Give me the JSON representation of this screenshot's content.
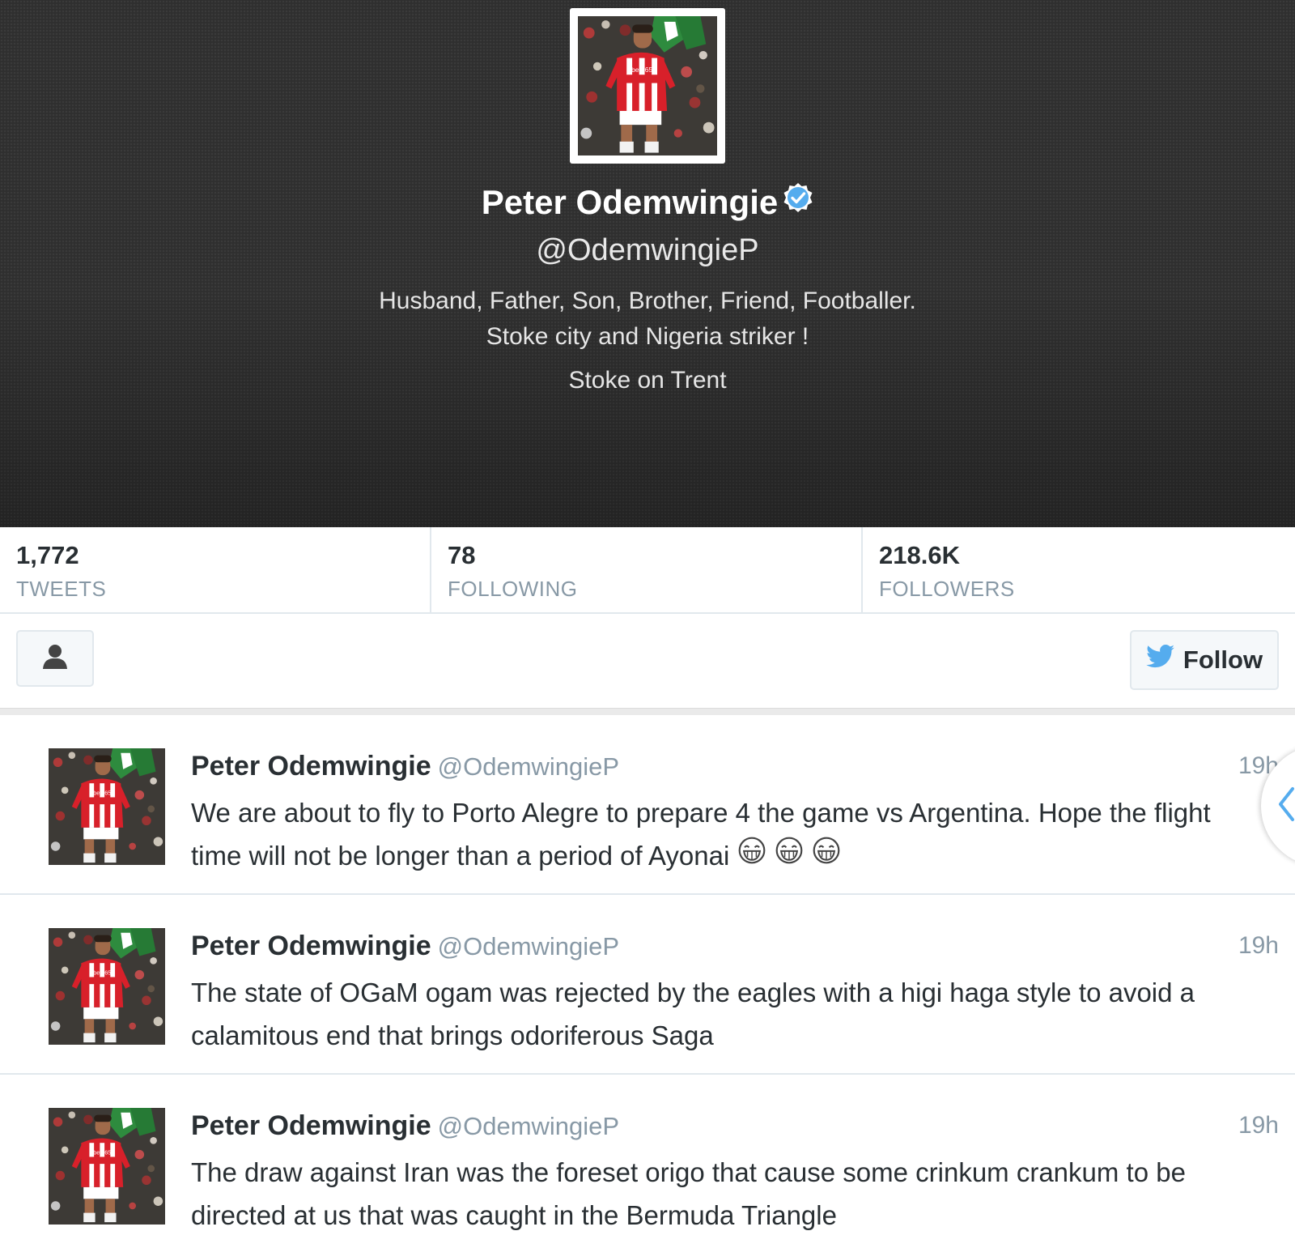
{
  "profile": {
    "name": "Peter Odemwingie",
    "handle": "@OdemwingieP",
    "bio_line1": "Husband, Father, Son, Brother, Friend, Footballer.",
    "bio_line2": "Stoke city and Nigeria striker !",
    "location": "Stoke on Trent",
    "verified": true,
    "avatar_jersey_text": "bet365"
  },
  "stats": [
    {
      "value": "1,772",
      "label": "TWEETS"
    },
    {
      "value": "78",
      "label": "FOLLOWING"
    },
    {
      "value": "218.6K",
      "label": "FOLLOWERS"
    }
  ],
  "actions": {
    "follow_label": "Follow",
    "user_icon": "person-icon",
    "follow_icon": "twitter-bird-icon"
  },
  "tweets": [
    {
      "name": "Peter Odemwingie",
      "handle": "@OdemwingieP",
      "time": "19h",
      "text": "We are about to fly to Porto Alegre to prepare 4 the game vs Argentina. Hope the flight time will not be longer than a period of Ayonai",
      "emoji_count": 3
    },
    {
      "name": "Peter Odemwingie",
      "handle": "@OdemwingieP",
      "time": "19h",
      "text": "The state of OGaM ogam was rejected by the eagles with a higi haga style to avoid a calamitous end that brings odoriferous Saga"
    },
    {
      "name": "Peter Odemwingie",
      "handle": "@OdemwingieP",
      "time": "19h",
      "text": "The draw against Iran was the foreset origo that cause some crinkum crankum to be directed at us that was caught in the Bermuda Triangle"
    }
  ],
  "colors": {
    "header_bg": "#2f2f2f",
    "verified_blue": "#55acee",
    "twitter_blue": "#55acee",
    "muted_text": "#8899a6"
  }
}
